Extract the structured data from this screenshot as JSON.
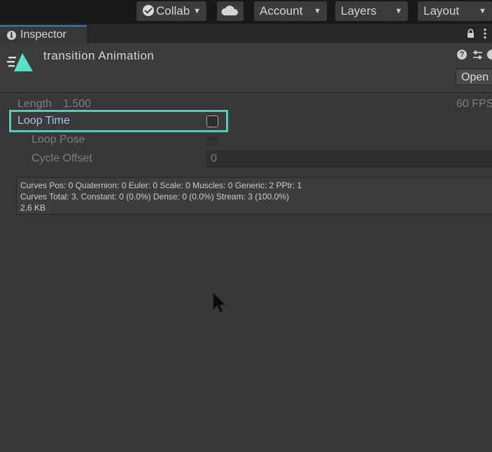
{
  "toolbar": {
    "collab_label": "Collab",
    "cloud_icon": "cloud-icon",
    "account_label": "Account",
    "layers_label": "Layers",
    "layout_label": "Layout"
  },
  "tabs": {
    "inspector_label": "Inspector"
  },
  "asset": {
    "title": "transition Animation",
    "open_button": "Open"
  },
  "properties": {
    "length_label": "Length",
    "length_value": "1.500",
    "fps_value": "60 FPS",
    "loop_time_label": "Loop Time",
    "loop_time_checked": false,
    "loop_pose_label": "Loop Pose",
    "cycle_offset_label": "Cycle Offset",
    "cycle_offset_value": "0"
  },
  "curves": {
    "line1": "Curves Pos: 0 Quaternion: 0 Euler: 0 Scale: 0 Muscles: 0 Generic: 2 PPtr: 1",
    "line2": "Curves Total: 3, Constant: 0 (0.0%) Dense: 0 (0.0%) Stream: 3 (100.0%)",
    "line3": "2.6 KB"
  },
  "colors": {
    "highlight": "#53cdbb",
    "accent_label": "#a5c6ec",
    "anim_icon": "#5ae0c8",
    "tab_underline": "#3a79bb"
  }
}
